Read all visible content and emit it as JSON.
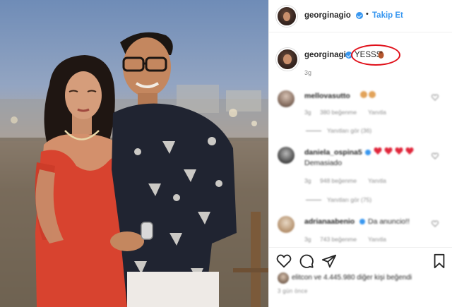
{
  "post": {
    "username": "georginagio",
    "follow_label": "Takip Et",
    "separator": "•",
    "caption_username": "georginagio",
    "caption_text": "YESSS",
    "caption_time": "3g"
  },
  "comments": [
    {
      "username": "mellovasutto",
      "text": "",
      "time": "3g",
      "likes": "380 beğenme",
      "reply": "Yanıtla",
      "view_replies": "Yanıtları gör (36)"
    },
    {
      "username": "daniela_ospina5",
      "text": "Demasiado",
      "time": "3g",
      "likes": "948 beğenme",
      "reply": "Yanıtla",
      "view_replies": "Yanıtları gör (75)"
    },
    {
      "username": "adrianaabenio",
      "text": "Da anuncio!!",
      "time": "3g",
      "likes": "743 beğenme",
      "reply": "Yanıtla"
    }
  ],
  "likes_text": "elitcon ve 4.445.980 diğer kişi beğendi",
  "post_time_label": "3 gün önce",
  "icons": {
    "like": "heart-icon",
    "comment": "comment-icon",
    "share": "paper-plane-icon",
    "save": "bookmark-icon",
    "verified": "verified-badge-icon"
  },
  "colors": {
    "accent": "#3897f0",
    "highlight": "#e0101a",
    "muted": "#8e8e8e"
  }
}
